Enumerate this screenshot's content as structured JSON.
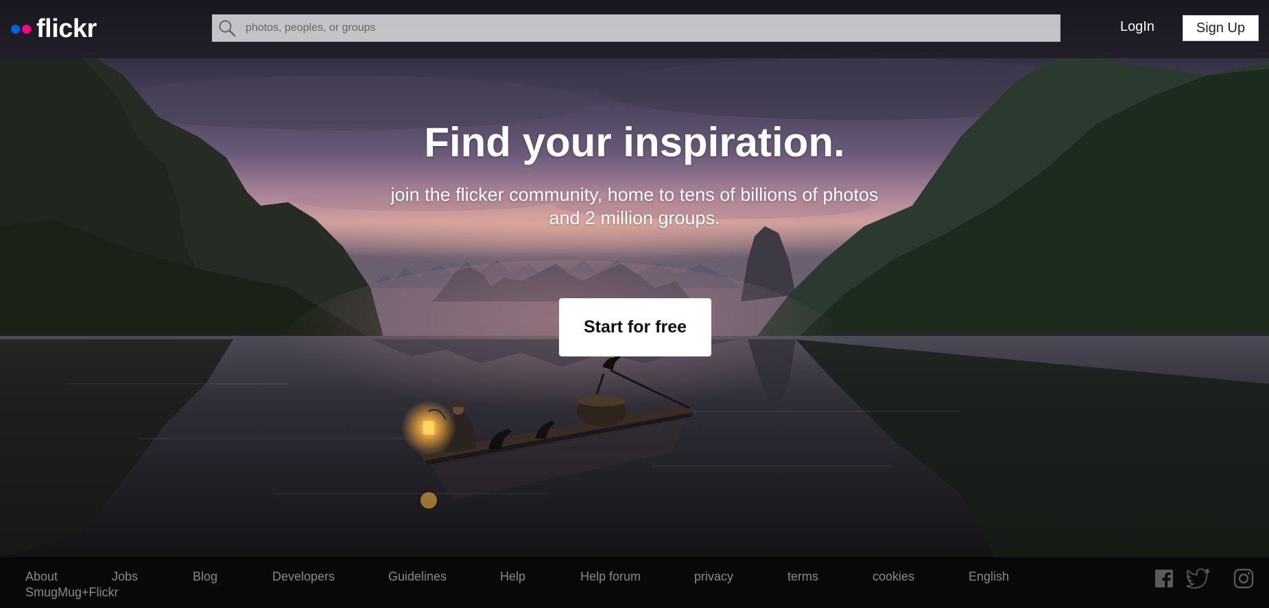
{
  "header": {
    "logo_text": "flickr",
    "search_placeholder": "photos, peoples, or groups",
    "login_label": "LogIn",
    "signup_label": "Sign Up"
  },
  "hero": {
    "title": "Find your inspiration.",
    "subtitle": "join the flicker community, home to tens of billions of photos and 2 million groups.",
    "cta_label": "Start for free",
    "background_icon": "landscape-photo"
  },
  "footer": {
    "links": [
      "About",
      "Jobs",
      "Blog",
      "Developers",
      "Guidelines",
      "Help",
      "Help forum",
      "privacy",
      "terms",
      "cookies",
      "English",
      "SmugMug+Flickr"
    ],
    "social_icons": [
      "facebook-icon",
      "twitter-icon",
      "instagram-icon"
    ]
  },
  "colors": {
    "brand_blue": "#0063dc",
    "brand_pink": "#ff0084",
    "footer_bg": "#080808",
    "footer_link": "#8a8a8a"
  }
}
